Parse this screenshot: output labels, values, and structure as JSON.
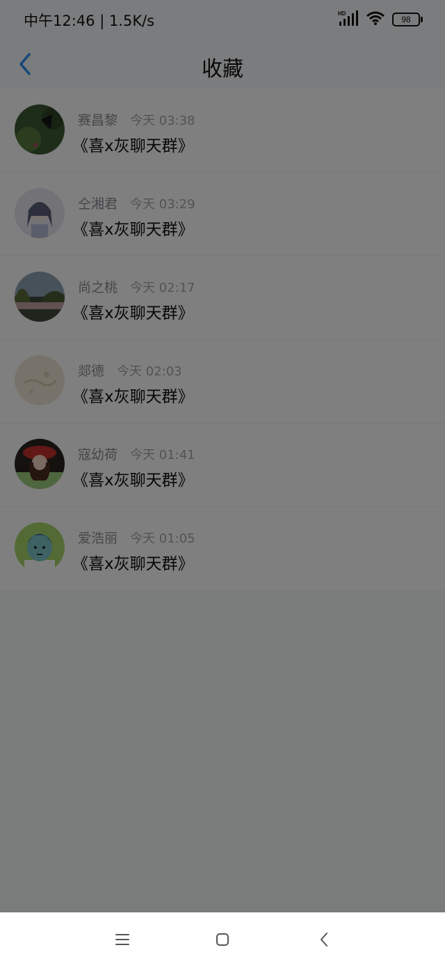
{
  "status_bar": {
    "text": "中午12:46 | 1.5K/s",
    "battery": "98",
    "network_badge": "HD"
  },
  "header": {
    "title": "收藏"
  },
  "items": [
    {
      "sender": "赛昌黎",
      "time": "今天 03:38",
      "title": "《喜x灰聊天群》"
    },
    {
      "sender": "仝湘君",
      "time": "今天 03:29",
      "title": "《喜x灰聊天群》"
    },
    {
      "sender": "尚之桃",
      "time": "今天 02:17",
      "title": "《喜x灰聊天群》"
    },
    {
      "sender": "郯德",
      "time": "今天 02:03",
      "title": "《喜x灰聊天群》"
    },
    {
      "sender": "寇幼荷",
      "time": "今天 01:41",
      "title": "《喜x灰聊天群》"
    },
    {
      "sender": "爱浩丽",
      "time": "今天 01:05",
      "title": "《喜x灰聊天群》"
    }
  ],
  "colors": {
    "accent": "#2b8ff5",
    "overlay": "rgba(0,0,0,0.5)"
  },
  "nav": {
    "menu_icon": "menu-icon",
    "home_icon": "home-icon",
    "back_icon": "back-icon"
  }
}
